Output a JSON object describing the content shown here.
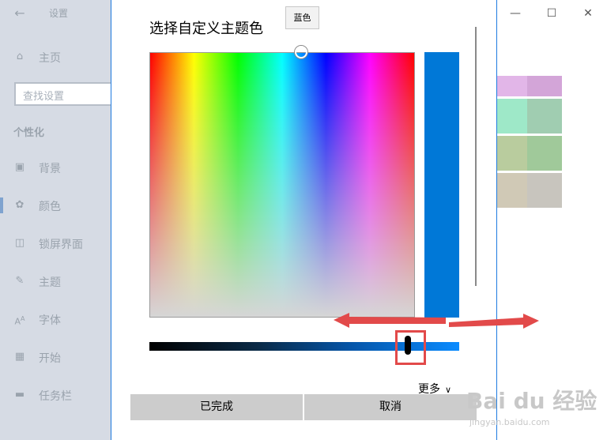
{
  "app": {
    "title": "设置"
  },
  "sidebar": {
    "search_placeholder": "查找设置",
    "section_header": "个性化",
    "items": [
      {
        "label": "主页",
        "icon": "home-icon"
      },
      {
        "label": "背景",
        "icon": "image-icon"
      },
      {
        "label": "颜色",
        "icon": "palette-icon"
      },
      {
        "label": "锁屏界面",
        "icon": "lock-screen-icon"
      },
      {
        "label": "主题",
        "icon": "theme-icon"
      },
      {
        "label": "字体",
        "icon": "font-icon"
      },
      {
        "label": "开始",
        "icon": "start-icon"
      },
      {
        "label": "任务栏",
        "icon": "taskbar-icon"
      }
    ]
  },
  "swatches": {
    "colors": [
      "#e2b6e8",
      "#d3a5d8",
      "#9ee8c8",
      "#a0cdb1",
      "#b9cc9e",
      "#a0c99a",
      "#d0c9b6",
      "#c8c5be"
    ]
  },
  "dialog": {
    "title": "选择自定义主题色",
    "tooltip": "蓝色",
    "selected_color": "#0078d7",
    "more_label": "更多",
    "done_label": "已完成",
    "cancel_label": "取消"
  },
  "colors": {
    "accent": "#0078d7",
    "annotation": "#e24a4a"
  },
  "watermark": {
    "logo_text": "Bai du 经验",
    "url": "jingyan.baidu.com"
  }
}
